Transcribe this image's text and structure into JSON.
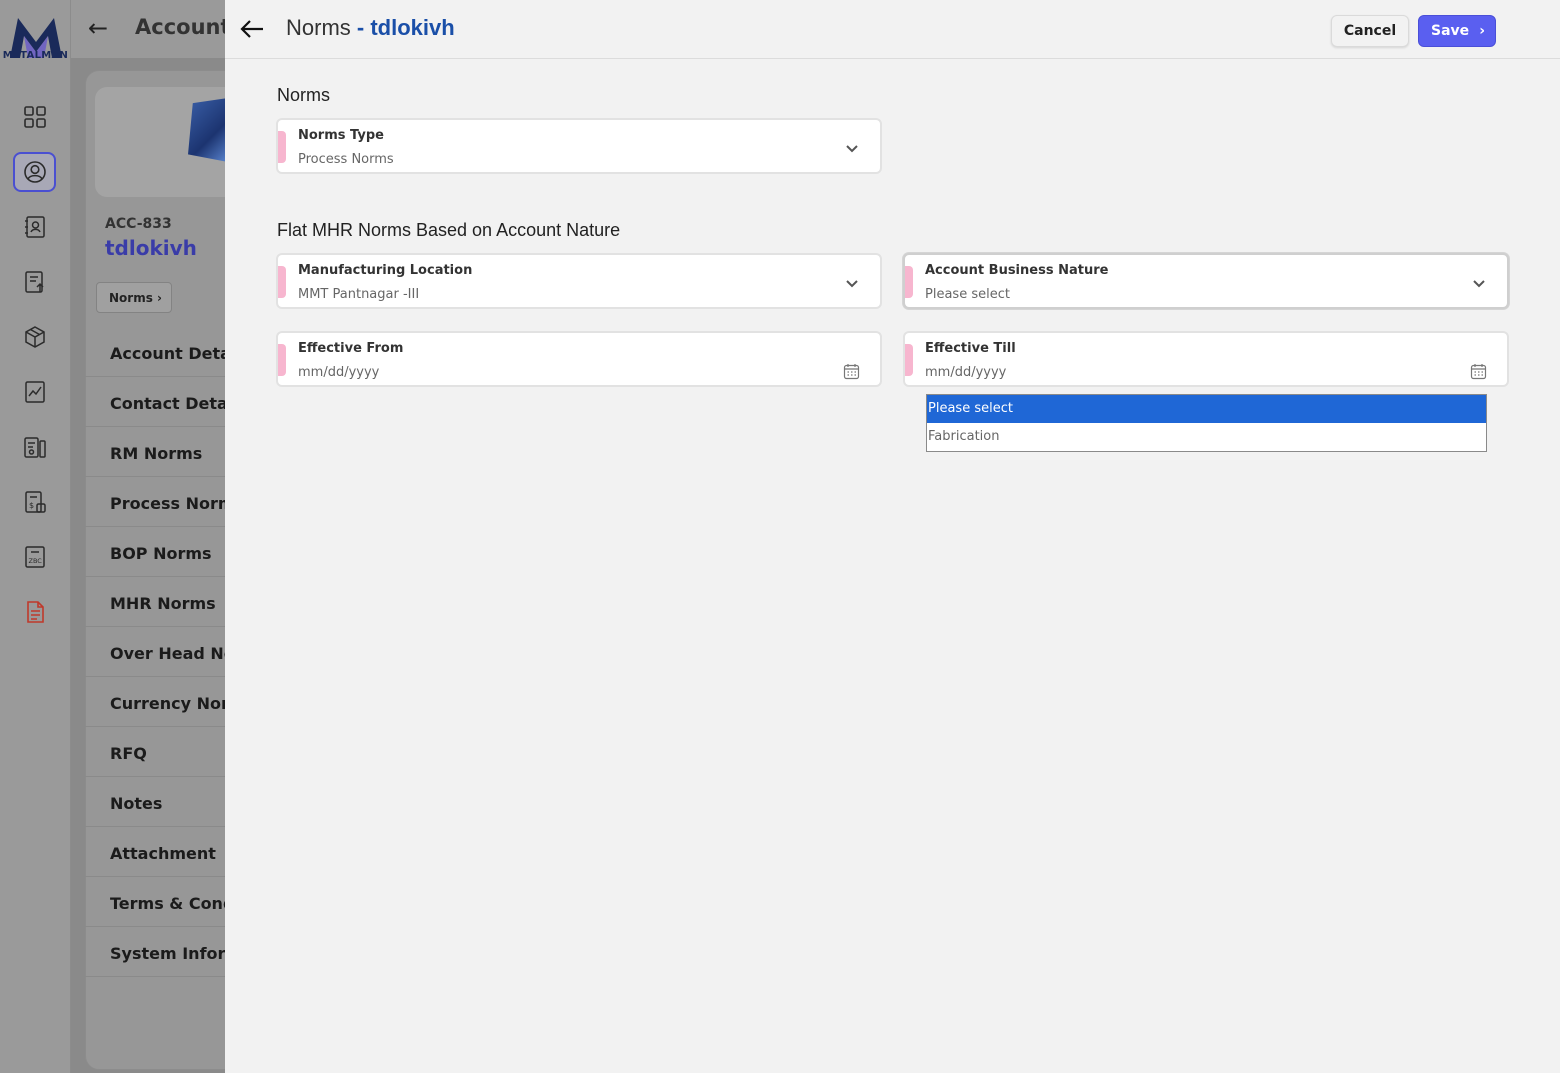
{
  "brand": {
    "logo_text": "METALMAN"
  },
  "background_page": {
    "header_title": "Account",
    "account_code": "ACC-833",
    "account_name": "tdlokivh",
    "norms_pill": "Norms",
    "menu": [
      "Account Details",
      "Contact Details",
      "RM Norms",
      "Process Norms",
      "BOP Norms",
      "MHR Norms",
      "Over Head Norms",
      "Currency Norms",
      "RFQ",
      "Notes",
      "Attachment",
      "Terms & Conditions",
      "System Information"
    ]
  },
  "rail_icons": [
    "dashboard-icon",
    "account-icon",
    "contacts-icon",
    "notes-upload-icon",
    "package-icon",
    "analytics-icon",
    "reports-icon",
    "pricing-icon",
    "zbc-icon",
    "document-icon"
  ],
  "panel": {
    "title": "Norms",
    "title_account": "- tdlokivh",
    "cancel_label": "Cancel",
    "save_label": "Save",
    "section1_title": "Norms",
    "norms_type": {
      "label": "Norms Type",
      "value": "Process Norms"
    },
    "section2_title": "Flat MHR Norms Based on Account Nature",
    "manufacturing_location": {
      "label": "Manufacturing Location",
      "value": "MMT Pantnagar -III"
    },
    "account_business_nature": {
      "label": "Account Business Nature",
      "value": "Please select"
    },
    "effective_from": {
      "label": "Effective From",
      "placeholder": "mm/dd/yyyy"
    },
    "effective_till": {
      "label": "Effective Till",
      "placeholder": "mm/dd/yyyy"
    },
    "dropdown_options": [
      "Please select",
      "Fabrication"
    ]
  },
  "colors": {
    "accent": "#5a5ff0",
    "title_accent": "#1a4fa8",
    "field_marker": "#f7b6cf",
    "selected_option": "#1f67d6"
  }
}
